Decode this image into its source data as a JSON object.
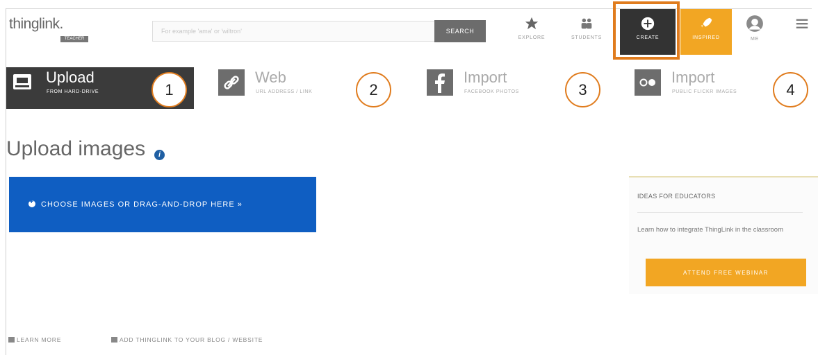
{
  "header": {
    "logo_text": "thinglink.",
    "logo_badge": "TEACHER",
    "search_placeholder": "For example 'ama' or 'wiltron'",
    "search_label": "SEARCH",
    "nav": [
      {
        "label": "EXPLORE",
        "icon": "star-icon"
      },
      {
        "label": "STUDENTS",
        "icon": "students-icon"
      },
      {
        "label": "CREATE",
        "icon": "plus-circle-icon"
      },
      {
        "label": "INSPIRED",
        "icon": "rocket-icon"
      },
      {
        "label": "ME",
        "icon": "avatar-icon"
      },
      {
        "label": "",
        "icon": "hamburger-menu-icon"
      }
    ]
  },
  "tabs": [
    {
      "title": "Upload",
      "subtitle": "FROM HARD-DRIVE",
      "number": "1",
      "icon": "hard-drive-icon"
    },
    {
      "title": "Web",
      "subtitle": "URL ADDRESS / LINK",
      "number": "2",
      "icon": "link-icon"
    },
    {
      "title": "Import",
      "subtitle": "FACEBOOK PHOTOS",
      "number": "3",
      "icon": "facebook-icon"
    },
    {
      "title": "Import",
      "subtitle": "PUBLIC FLICKR IMAGES",
      "number": "4",
      "icon": "flickr-icon"
    }
  ],
  "main": {
    "title": "Upload images",
    "help_glyph": "i",
    "choose_label": "CHOOSE IMAGES OR DRAG-AND-DROP HERE »"
  },
  "ideas": {
    "title": "IDEAS FOR EDUCATORS",
    "text": "Learn how to integrate ThingLink in the classroom",
    "button": "ATTEND FREE WEBINAR"
  },
  "footer": {
    "learn_more": "LEARN MORE",
    "add_thinglink": "ADD THINGLINK TO YOUR BLOG / WEBSITE"
  },
  "colors": {
    "accent_orange": "#e07c1e",
    "inspired_orange": "#f2a623",
    "choose_blue": "#0f5ec2",
    "dark_tab": "#3b3b3b"
  }
}
